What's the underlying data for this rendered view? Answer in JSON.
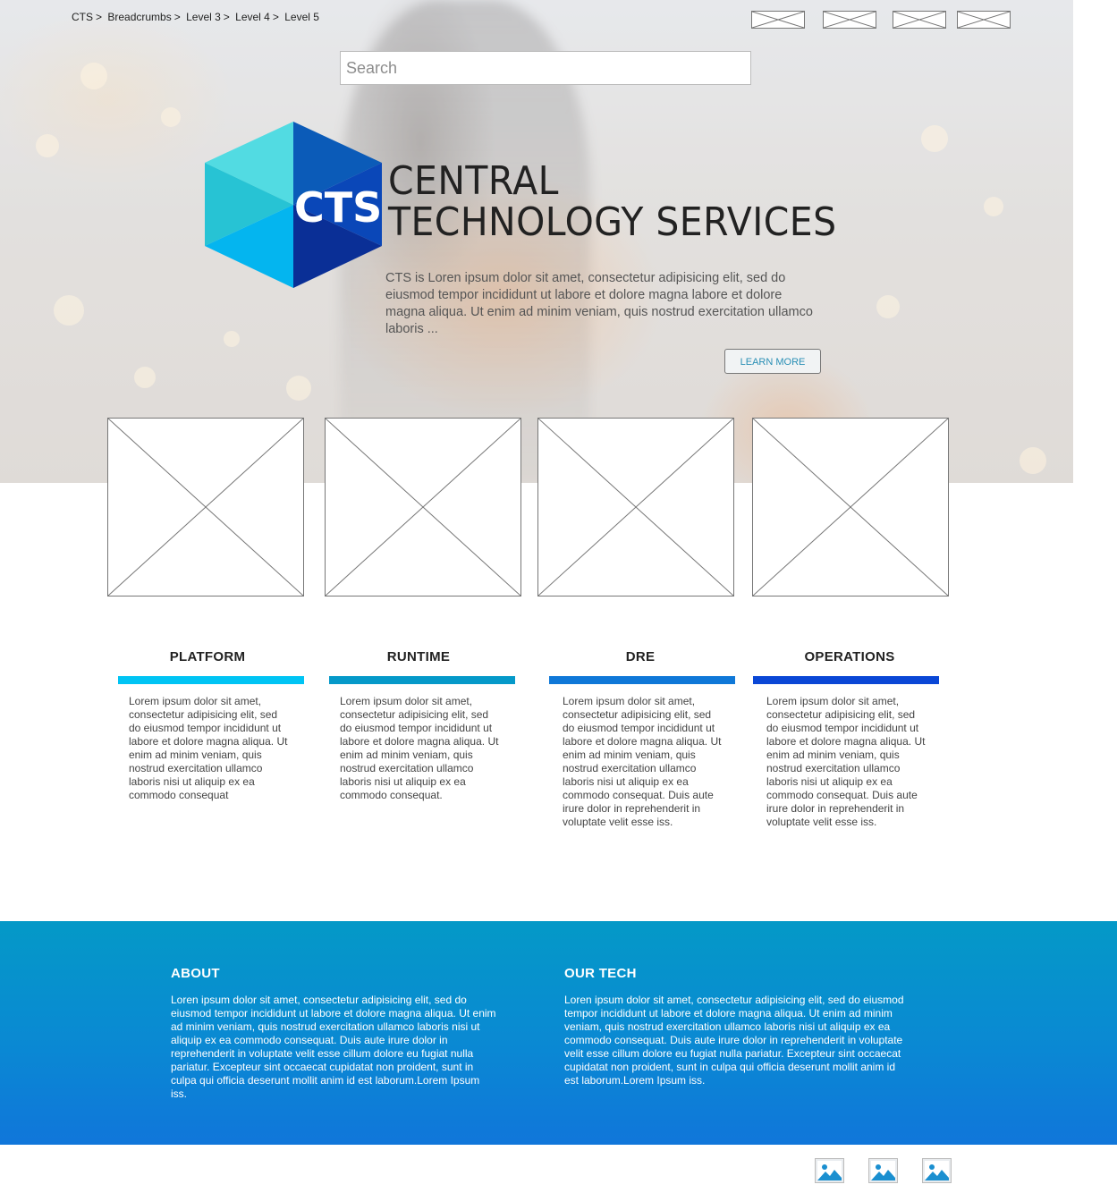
{
  "breadcrumb": {
    "items": [
      "CTS",
      "Breadcrumbs",
      "Level 3",
      "Level 4",
      "Level 5"
    ],
    "separator": ">"
  },
  "search": {
    "placeholder": "Search"
  },
  "logo": {
    "badge_text": "CTS",
    "line1": "CENTRAL",
    "line2": "TECHNOLOGY SERVICES",
    "colors": {
      "teal_light": "#6fe3e6",
      "teal": "#27c3d4",
      "blue": "#0a6fd0",
      "navy": "#0b2f8f",
      "cyan": "#04b5ef"
    }
  },
  "hero": {
    "description": "CTS is Loren ipsum dolor sit amet, consectetur adipisicing elit, sed do eiusmod tempor incididunt ut labore et dolore magna labore et dolore magna aliqua. Ut enim ad minim veniam, quis nostrud exercitation ullamco laboris ...",
    "learn_more_label": "LEARN MORE"
  },
  "columns": [
    {
      "title": "PLATFORM",
      "bar_color": "#00c4f4",
      "text": "Lorem ipsum dolor sit amet, consectetur adipisicing elit, sed do eiusmod tempor incididunt ut labore et dolore magna aliqua. Ut enim ad minim veniam, quis nostrud exercitation ullamco laboris nisi ut aliquip ex ea commodo consequat"
    },
    {
      "title": "RUNTIME",
      "bar_color": "#0599c9",
      "text": "Lorem ipsum dolor sit amet, consectetur adipisicing elit, sed do eiusmod tempor incididunt ut labore et dolore magna aliqua. Ut enim ad minim veniam, quis nostrud exercitation ullamco laboris nisi ut aliquip ex ea commodo consequat."
    },
    {
      "title": "DRE",
      "bar_color": "#0f78d8",
      "text": "Lorem ipsum dolor sit amet, consectetur adipisicing elit, sed do eiusmod tempor incididunt ut labore et dolore magna aliqua. Ut enim ad minim veniam, quis nostrud exercitation ullamco laboris nisi ut aliquip ex ea commodo consequat. Duis aute irure dolor in reprehenderit in voluptate velit esse iss."
    },
    {
      "title": "OPERATIONS",
      "bar_color": "#0a47d6",
      "text": "Lorem ipsum dolor sit amet, consectetur adipisicing elit, sed do eiusmod tempor incididunt ut labore et dolore magna aliqua. Ut enim ad minim veniam, quis nostrud exercitation ullamco laboris nisi ut aliquip ex ea commodo consequat. Duis aute irure dolor in reprehenderit in voluptate velit esse iss."
    }
  ],
  "footer": {
    "about": {
      "title": "ABOUT",
      "text": "Loren ipsum dolor sit amet, consectetur adipisicing elit, sed do eiusmod tempor incididunt ut labore et dolore magna aliqua. Ut enim ad minim veniam, quis nostrud exercitation ullamco laboris nisi ut aliquip ex ea commodo consequat. Duis aute irure dolor in reprehenderit in voluptate velit esse cillum dolore eu fugiat nulla pariatur. Excepteur sint occaecat cupidatat non proident, sunt in culpa qui officia deserunt mollit anim id est laborum.Lorem Ipsum iss."
    },
    "our_tech": {
      "title": "OUR TECH",
      "text": "Loren ipsum dolor sit amet, consectetur adipisicing elit, sed do eiusmod tempor incididunt ut labore et dolore magna aliqua. Ut enim ad minim veniam, quis nostrud exercitation ullamco laboris nisi ut aliquip ex ea commodo consequat. Duis aute irure dolor in reprehenderit in voluptate velit esse cillum dolore eu fugiat nulla pariatur. Excepteur sint occaecat cupidatat non proident, sunt in culpa qui officia deserunt mollit anim id est laborum.Lorem Ipsum iss."
    },
    "band_colors": [
      "#0499c7",
      "#1076da"
    ]
  },
  "icons": {
    "header_placeholders": [
      "image-placeholder-icon",
      "image-placeholder-icon",
      "image-placeholder-icon",
      "image-placeholder-icon"
    ],
    "social": [
      "image-icon",
      "image-icon",
      "image-icon"
    ]
  }
}
